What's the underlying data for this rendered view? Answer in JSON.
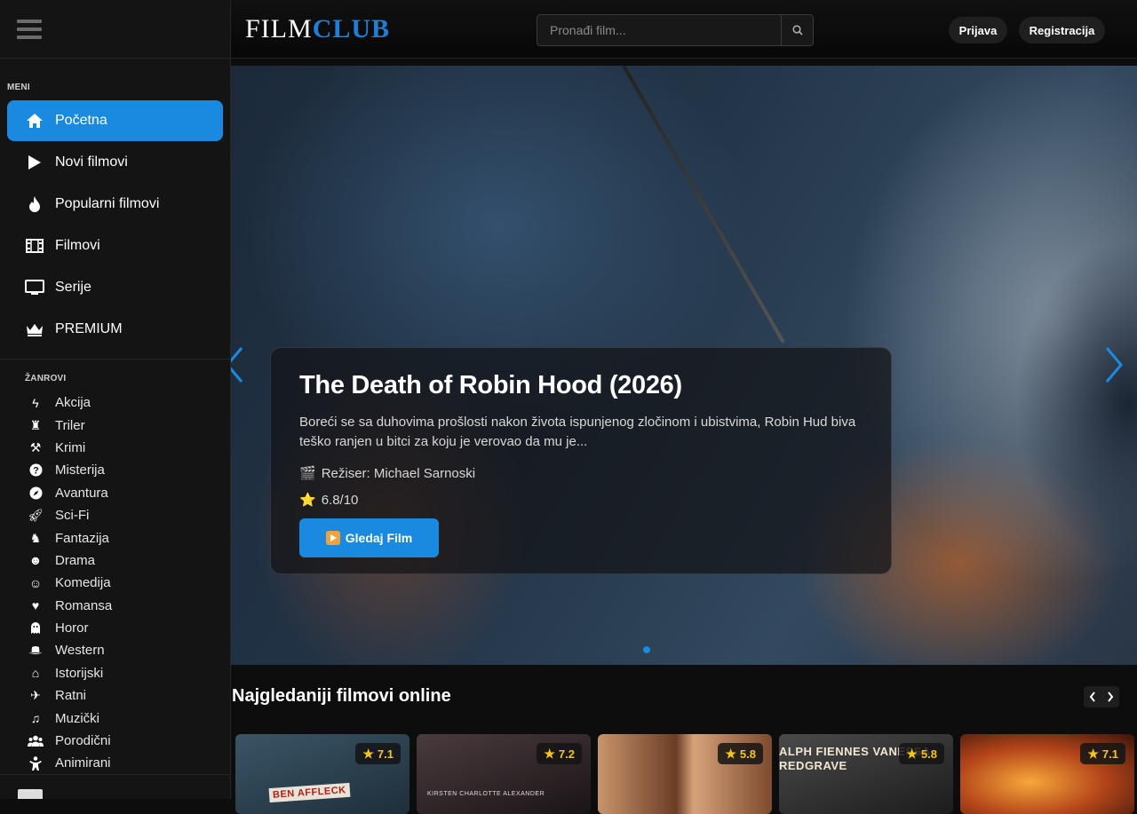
{
  "sidebar": {
    "menu_label": "MENI",
    "menu": [
      {
        "label": "Početna",
        "icon": "home-icon",
        "active": true
      },
      {
        "label": "Novi filmovi",
        "icon": "play-icon"
      },
      {
        "label": "Popularni filmovi",
        "icon": "fire-icon"
      },
      {
        "label": "Filmovi",
        "icon": "film-icon"
      },
      {
        "label": "Serije",
        "icon": "tv-icon"
      },
      {
        "label": "PREMIUM",
        "icon": "crown-icon"
      }
    ],
    "genres_label": "ŽANROVI",
    "genres": [
      {
        "label": "Akcija",
        "icon": "bolt-icon"
      },
      {
        "label": "Triler",
        "icon": "spy-icon"
      },
      {
        "label": "Krimi",
        "icon": "gavel-icon"
      },
      {
        "label": "Misterija",
        "icon": "question-icon"
      },
      {
        "label": "Avantura",
        "icon": "compass-icon"
      },
      {
        "label": "Sci-Fi",
        "icon": "rocket-icon"
      },
      {
        "label": "Fantazija",
        "icon": "dragon-icon"
      },
      {
        "label": "Drama",
        "icon": "masks-icon"
      },
      {
        "label": "Komedija",
        "icon": "laugh-icon"
      },
      {
        "label": "Romansa",
        "icon": "heart-icon"
      },
      {
        "label": "Horor",
        "icon": "ghost-icon"
      },
      {
        "label": "Western",
        "icon": "hat-icon"
      },
      {
        "label": "Istorijski",
        "icon": "landmark-icon"
      },
      {
        "label": "Ratni",
        "icon": "plane-icon"
      },
      {
        "label": "Muzički",
        "icon": "music-icon"
      },
      {
        "label": "Porodični",
        "icon": "users-icon"
      },
      {
        "label": "Animirani",
        "icon": "child-icon"
      }
    ]
  },
  "header": {
    "logo_part1": "FILM",
    "logo_part2": "CLUB",
    "search_placeholder": "Pronađi film...",
    "login_label": "Prijava",
    "register_label": "Registracija"
  },
  "hero": {
    "title": "The Death of Robin Hood (2026)",
    "description": "Boreći se sa duhovima prošlosti nakon života ispunjenog zločinom i ubistvima, Robin Hud biva teško ranjen u bitci za koju je verovao da mu je...",
    "director_icon": "🎬",
    "director": "Režiser: Michael Sarnoski",
    "rating_icon": "⭐",
    "rating": "6.8/10",
    "watch_label": "Gledaj Film",
    "accent": "#1a8ae0"
  },
  "popular": {
    "title": "Najgledaniji filmovi online",
    "posters": [
      {
        "rating": "7.1",
        "text": "BEN AFFLECK",
        "bg": "#2b4253"
      },
      {
        "rating": "7.2",
        "text": "KIRSTEN  CHARLOTTE  ALEXANDER",
        "bg": "#3a2a2c"
      },
      {
        "rating": "5.8",
        "text": "",
        "bg": "#8a5a3a"
      },
      {
        "rating": "5.8",
        "text": "ALPH FIENNES  VANESSA REDGRAVE",
        "bg": "#2c2c2c"
      },
      {
        "rating": "7.1",
        "text": "",
        "bg": "#b04818"
      }
    ]
  }
}
